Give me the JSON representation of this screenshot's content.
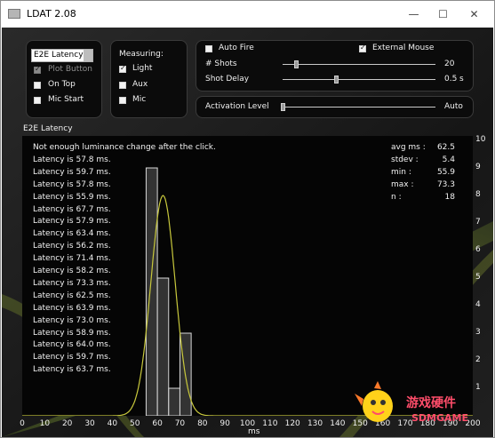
{
  "window": {
    "title": "LDAT 2.08",
    "minimize": "—",
    "maximize": "☐",
    "close": "✕"
  },
  "mode_panel": {
    "mode_select": "E2E Latency",
    "options": [
      {
        "label": "Plot Button",
        "checked": true,
        "disabled": true
      },
      {
        "label": "On Top",
        "checked": false,
        "disabled": false
      },
      {
        "label": "Mic Start",
        "checked": false,
        "disabled": false
      }
    ]
  },
  "measuring_panel": {
    "heading": "Measuring:",
    "options": [
      {
        "label": "Light",
        "checked": true
      },
      {
        "label": "Aux",
        "checked": false
      },
      {
        "label": "Mic",
        "checked": false
      }
    ]
  },
  "shots_panel": {
    "auto_fire_label": "Auto Fire",
    "auto_fire_checked": false,
    "external_mouse_label": "External Mouse",
    "external_mouse_checked": true,
    "shots_label": "# Shots",
    "shots_value": "20",
    "shots_level": 0.08,
    "shot_delay_label": "Shot Delay",
    "shot_delay_value": "0.5",
    "shot_delay_unit": "s",
    "shot_delay_level": 0.35
  },
  "activation_panel": {
    "label": "Activation Level",
    "value": "Auto",
    "level": 0.0
  },
  "plot_title": "E2E Latency",
  "log": [
    "Not enough luminance change after the click.",
    "Latency is 57.8 ms.",
    "Latency is 59.7 ms.",
    "Latency is 57.8 ms.",
    "Latency is 55.9 ms.",
    "Latency is 67.7 ms.",
    "Latency is 57.9 ms.",
    "Latency is 63.4 ms.",
    "Latency is 56.2 ms.",
    "Latency is 71.4 ms.",
    "Latency is 58.2 ms.",
    "Latency is 73.3 ms.",
    "Latency is 62.5 ms.",
    "Latency is 63.9 ms.",
    "Latency is 73.0 ms.",
    "Latency is 58.9 ms.",
    "Latency is 64.0 ms.",
    "Latency is 59.7 ms.",
    "Latency is 63.7 ms."
  ],
  "stats": [
    {
      "label": "avg ms :",
      "value": "62.5"
    },
    {
      "label": "stdev :",
      "value": "5.4"
    },
    {
      "label": "min :",
      "value": "55.9"
    },
    {
      "label": "max :",
      "value": "73.3"
    },
    {
      "label": "n :",
      "value": "18"
    }
  ],
  "chart_data": {
    "type": "bar",
    "title": "E2E Latency",
    "xlabel": "ms",
    "ylabel": "",
    "xlim": [
      0,
      200
    ],
    "ylim": [
      0,
      10
    ],
    "x_ticks": [
      "0",
      "10",
      "20",
      "30",
      "40",
      "50",
      "60",
      "70",
      "80",
      "90",
      "100",
      "110",
      "120",
      "130",
      "140",
      "150",
      "160",
      "170",
      "180",
      "190",
      "200"
    ],
    "y_ticks": [
      "1",
      "2",
      "3",
      "4",
      "5",
      "6",
      "7",
      "8",
      "9",
      "10"
    ],
    "bins": [
      {
        "start": 55,
        "end": 60,
        "count": 9
      },
      {
        "start": 60,
        "end": 65,
        "count": 5
      },
      {
        "start": 65,
        "end": 70,
        "count": 1
      },
      {
        "start": 70,
        "end": 75,
        "count": 3
      }
    ],
    "fit_curve": {
      "type": "normal",
      "mean": 62.5,
      "stdev": 5.4,
      "peak": 8
    },
    "colors": {
      "bar_fill": "#5a5a5a",
      "bar_stroke": "#d8d8d8",
      "curve": "#c8c83c"
    }
  },
  "watermark": {
    "line1": "游戏硬件",
    "line2": "SDMGAME"
  }
}
